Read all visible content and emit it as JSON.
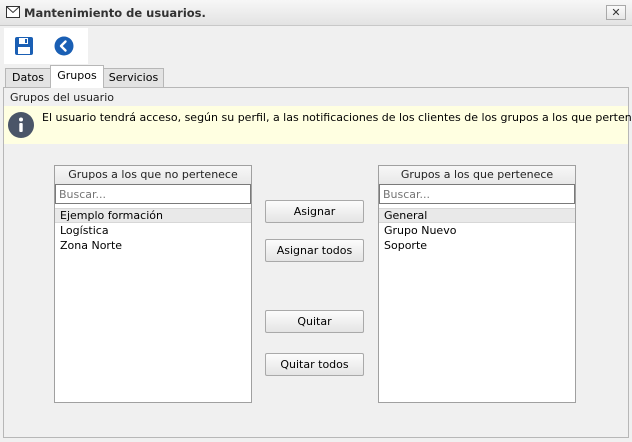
{
  "window": {
    "title": "Mantenimiento de usuarios.",
    "close_label": "✕"
  },
  "toolbar": {
    "save_icon": "save-icon",
    "back_icon": "back-icon"
  },
  "tabs": [
    {
      "label": "Datos",
      "active": false
    },
    {
      "label": "Grupos",
      "active": true
    },
    {
      "label": "Servicios",
      "active": false
    }
  ],
  "section": {
    "title": "Grupos del usuario",
    "info_text": "El usuario tendrá acceso, según su perfil, a las notificaciones de los clientes de los grupos a los que pertenece"
  },
  "not_member": {
    "header": "Grupos a los que no pertenece",
    "search_placeholder": "Buscar...",
    "items": [
      "Ejemplo formación",
      "Logística",
      "Zona Norte"
    ]
  },
  "member": {
    "header": "Grupos a los que pertenece",
    "search_placeholder": "Buscar...",
    "items": [
      "General",
      "Grupo Nuevo",
      "Soporte"
    ]
  },
  "buttons": {
    "assign": "Asignar",
    "assign_all": "Asignar todos",
    "remove": "Quitar",
    "remove_all": "Quitar todos"
  },
  "colors": {
    "info_bg": "#ffffe1",
    "accent": "#1a5fb4",
    "info_icon": "#4a5568"
  }
}
